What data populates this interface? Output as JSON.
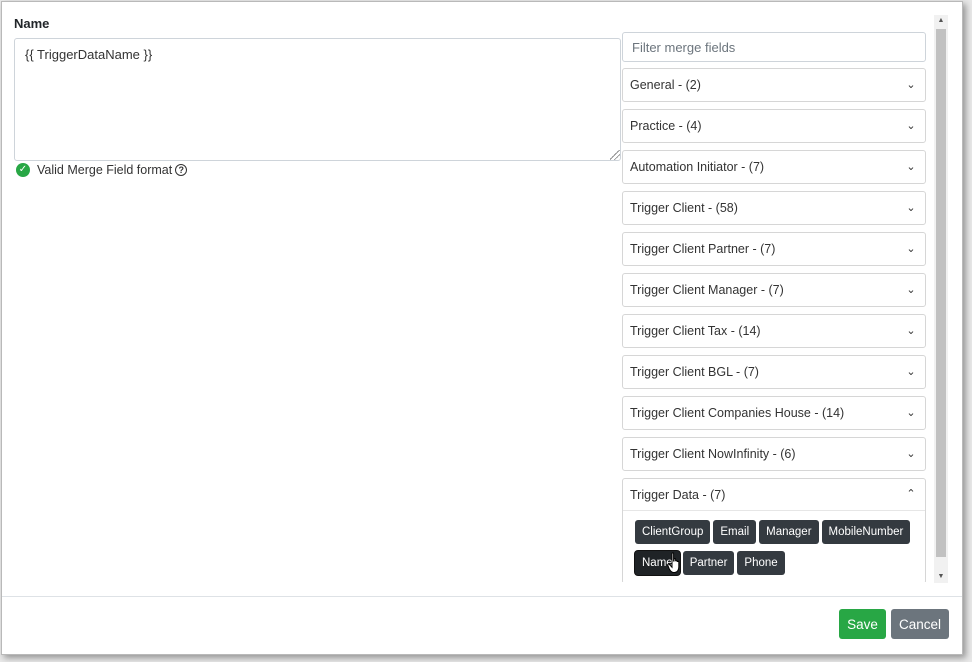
{
  "name_field": {
    "label": "Name",
    "value": "{{ TriggerDataName }}",
    "validation_text": "Valid Merge Field format",
    "validation_color": "#28a745"
  },
  "merge_fields": {
    "filter_placeholder": "Filter merge fields",
    "groups": [
      {
        "label": "General - (2)",
        "expanded": false
      },
      {
        "label": "Practice - (4)",
        "expanded": false
      },
      {
        "label": "Automation Initiator - (7)",
        "expanded": false
      },
      {
        "label": "Trigger Client - (58)",
        "expanded": false
      },
      {
        "label": "Trigger Client Partner - (7)",
        "expanded": false
      },
      {
        "label": "Trigger Client Manager - (7)",
        "expanded": false
      },
      {
        "label": "Trigger Client Tax - (14)",
        "expanded": false
      },
      {
        "label": "Trigger Client BGL - (7)",
        "expanded": false
      },
      {
        "label": "Trigger Client Companies House - (14)",
        "expanded": false
      },
      {
        "label": "Trigger Client NowInfinity - (6)",
        "expanded": false
      },
      {
        "label": "Trigger Data - (7)",
        "expanded": true,
        "fields": [
          "ClientGroup",
          "Email",
          "Manager",
          "MobileNumber",
          "Name",
          "Partner",
          "Phone"
        ]
      }
    ],
    "hovered_field": "Name"
  },
  "icons": {
    "collapsed": "chevron-down-icon",
    "expanded": "chevron-up-icon",
    "valid": "check-circle-icon",
    "help": "question-circle-icon"
  },
  "footer": {
    "save_label": "Save",
    "cancel_label": "Cancel",
    "save_color": "#28a745",
    "cancel_color": "#6c757d"
  }
}
